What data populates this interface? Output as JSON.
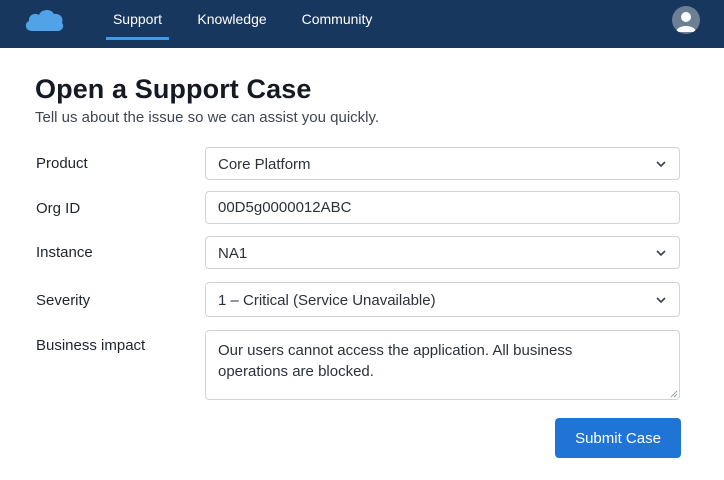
{
  "nav": {
    "tabs": [
      {
        "label": "Support"
      },
      {
        "label": "Knowledge"
      },
      {
        "label": "Community"
      }
    ],
    "active_tab": "Support",
    "logo_icon": "cloud-icon",
    "avatar_icon": "user-avatar-icon"
  },
  "page": {
    "title": "Open a Support Case",
    "subtitle": "Tell us about the issue so we can assist you quickly."
  },
  "form": {
    "product": {
      "label": "Product",
      "value": "Core Platform",
      "type": "select"
    },
    "org_id": {
      "label": "Org ID",
      "value": "00D5g0000012ABC",
      "type": "input"
    },
    "instance": {
      "label": "Instance",
      "value": "NA1",
      "type": "select"
    },
    "severity": {
      "label": "Severity",
      "value": "1 – Critical (Service Unavailable)",
      "type": "select"
    },
    "business_impact": {
      "label": "Business impact",
      "value": "Our users cannot access the application. All business\noperations are blocked.",
      "type": "textarea"
    },
    "submit_label": "Submit Case"
  },
  "colors": {
    "topbar": "#17375f",
    "active_tab_underline": "#3f9ae8",
    "primary_button": "#1f74d6",
    "logo": "#4fa3e6"
  }
}
